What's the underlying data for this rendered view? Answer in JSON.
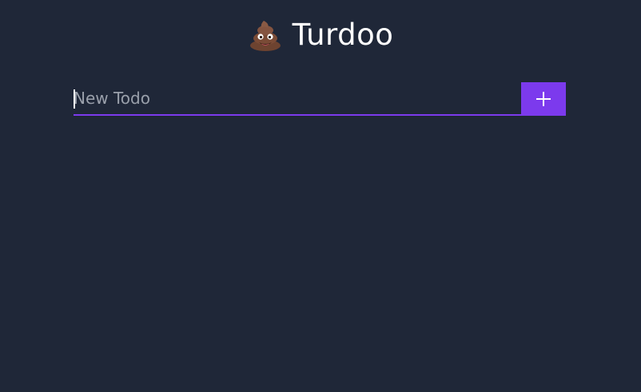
{
  "app": {
    "title": "Turdoo",
    "logo_icon": "pile-of-poo-icon",
    "background_color": "#1f2738",
    "accent_color": "#7c3aed"
  },
  "todo_form": {
    "input_value": "",
    "input_placeholder": "New Todo",
    "add_button_icon": "plus-icon"
  }
}
